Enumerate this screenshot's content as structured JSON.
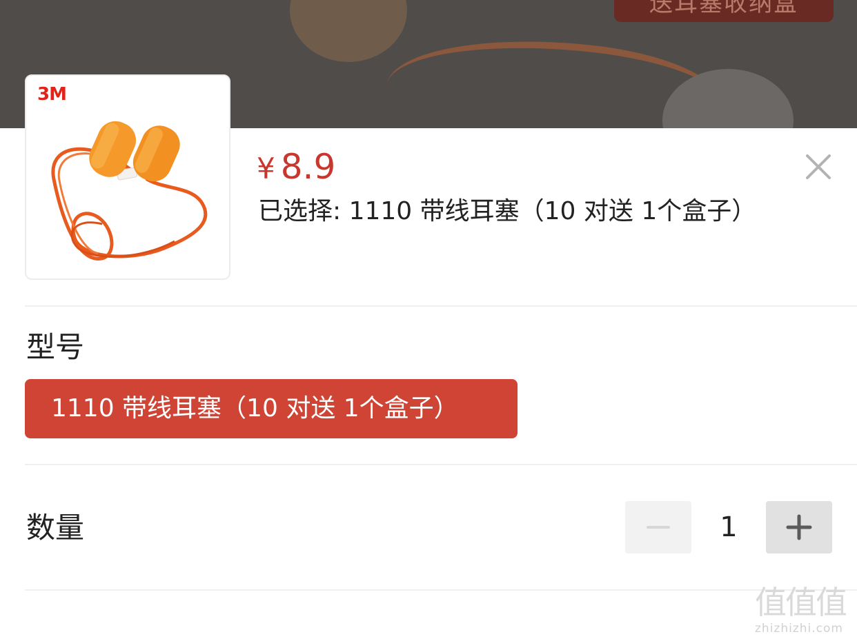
{
  "backdrop": {
    "banner_text": "送耳塞收纳盒"
  },
  "product": {
    "brand_logo": "3M",
    "price_currency": "¥",
    "price_value": "8.9",
    "selected_text": "已选择: 1110 带线耳塞（10 对送 1个盒子）"
  },
  "model_section": {
    "title": "型号",
    "options": [
      {
        "label": "1110 带线耳塞（10 对送 1个盒子）",
        "selected": true
      }
    ]
  },
  "quantity_section": {
    "title": "数量",
    "value": "1",
    "minus_icon": "minus-icon",
    "plus_icon": "plus-icon"
  },
  "close_icon": "close-icon",
  "watermark": {
    "glyphs": "值值值",
    "site": "zhizhizhi.com"
  },
  "colors": {
    "accent": "#cf4434",
    "price": "#c8372d",
    "stepper_disabled": "#f2f2f2",
    "stepper_enabled": "#e1e1e1"
  }
}
